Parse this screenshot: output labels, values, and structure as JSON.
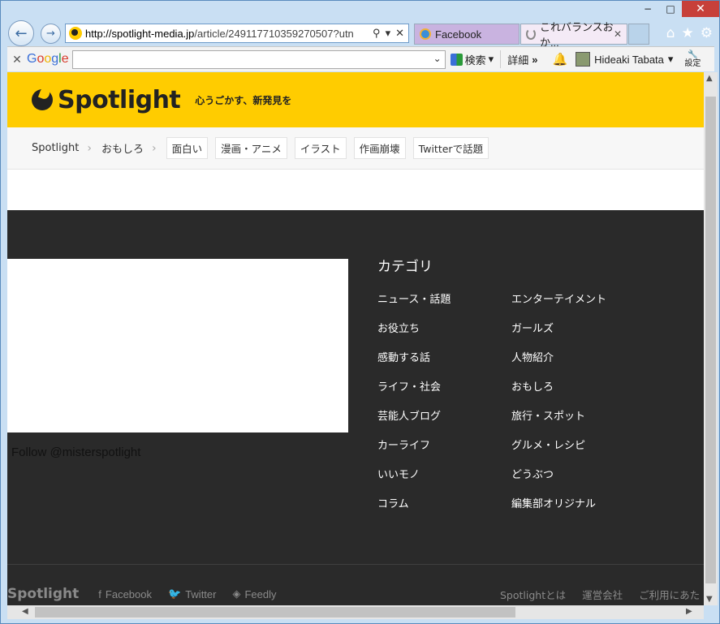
{
  "browser": {
    "address_host": "http://spotlight-media.jp",
    "address_path": "/article/249117710359270507?utn",
    "tabs": [
      {
        "label": "Facebook"
      },
      {
        "label": "これバランスおか..."
      }
    ],
    "window_controls": {
      "minimize": "−",
      "maximize": "□",
      "close": "✕"
    }
  },
  "google_toolbar": {
    "logo": [
      "G",
      "o",
      "o",
      "g",
      "l",
      "e"
    ],
    "search_value": "",
    "search_label": "検索",
    "detail_label": "詳細",
    "more_symbol": "»",
    "user_name": "Hideaki Tabata",
    "settings_label": "設定"
  },
  "site": {
    "logo_text": "Spotlight",
    "tagline": "心うごかす、新発見を",
    "breadcrumbs": [
      "Spotlight",
      "おもしろ"
    ],
    "tags": [
      "面白い",
      "漫画・アニメ",
      "イラスト",
      "作画崩壊",
      "Twitterで話題"
    ]
  },
  "footer": {
    "follow_text": "Follow @misterspotlight",
    "category_title": "カテゴリ",
    "categories_left": [
      "ニュース・話題",
      "お役立ち",
      "感動する話",
      "ライフ・社会",
      "芸能人ブログ",
      "カーライフ",
      "いいモノ",
      "コラム"
    ],
    "categories_right": [
      "エンターテイメント",
      "ガールズ",
      "人物紹介",
      "おもしろ",
      "旅行・スポット",
      "グルメ・レシピ",
      "どうぶつ",
      "編集部オリジナル"
    ],
    "logo_text": "Spotlight",
    "social": [
      "Facebook",
      "Twitter",
      "Feedly"
    ],
    "links": [
      "Spotlightとは",
      "運営会社",
      "ご利用にあた"
    ]
  }
}
